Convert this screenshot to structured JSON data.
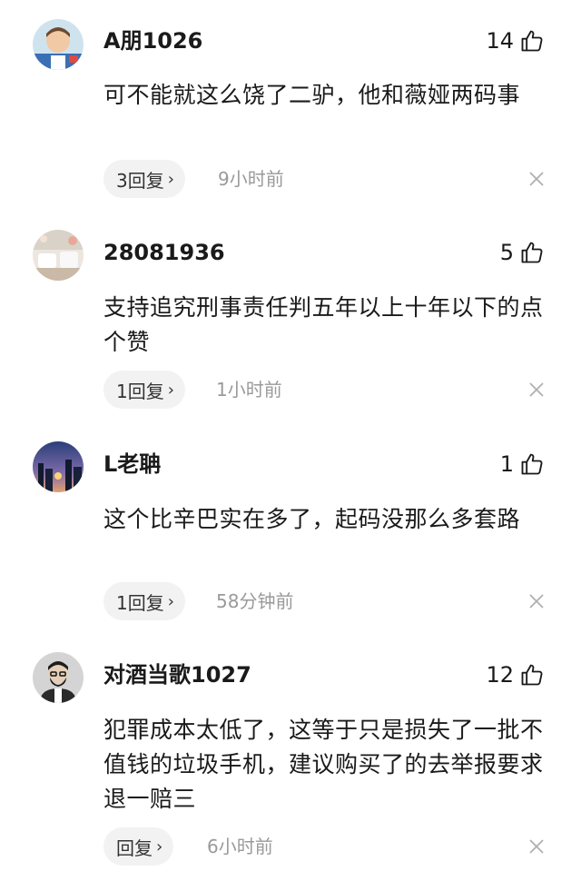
{
  "comments": [
    {
      "username": "A朋1026",
      "likes": "14",
      "text": "可不能就这么饶了二驴，他和薇娅两码事",
      "reply_label": "3回复",
      "time": "9小时前",
      "avatar": "cartoon-man-avatar"
    },
    {
      "username": "28081936",
      "likes": "5",
      "text": "支持追究刑事责任判五年以上十年以下的点个赞",
      "reply_label": "1回复",
      "time": "1小时前",
      "avatar": "room-photo-avatar"
    },
    {
      "username": "L老聃",
      "likes": "1",
      "text": "这个比辛巴实在多了，起码没那么多套路",
      "reply_label": "1回复",
      "time": "58分钟前",
      "avatar": "city-night-avatar"
    },
    {
      "username": "对酒当歌1027",
      "likes": "12",
      "text": "犯罪成本太低了，这等于只是损失了一批不值钱的垃圾手机，建议购买了的去举报要求退一赔三",
      "reply_label": "回复",
      "time": "6小时前",
      "avatar": "bearded-man-avatar"
    }
  ],
  "icons": {
    "like": "thumbs-up-icon",
    "close": "close-icon",
    "chevron": "chevron-right-icon"
  }
}
